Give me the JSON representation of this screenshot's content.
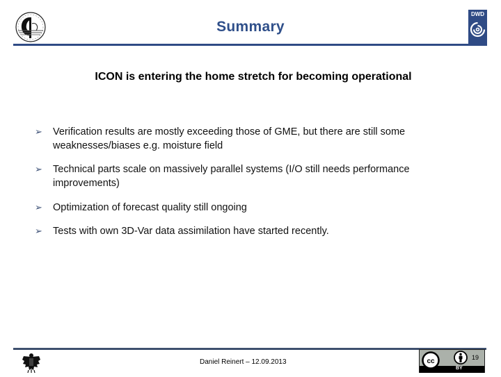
{
  "header": {
    "title": "Summary",
    "left_logo": "institute-emblem-icon",
    "right_logo": {
      "text": "DWD",
      "icon": "dwd-swirl-icon"
    }
  },
  "subtitle": "ICON is entering the home stretch for becoming operational",
  "bullets": [
    {
      "marker": "➢",
      "text": "Verification results are mostly exceeding those of GME, but there are still some weaknesses/biases e.g. moisture field"
    },
    {
      "marker": "➢",
      "text": "Technical parts scale on massively parallel systems (I/O still needs performance improvements)"
    },
    {
      "marker": "➢",
      "text": "Optimization of forecast quality still ongoing"
    },
    {
      "marker": "➢",
      "text": "Tests with own 3D-Var data assimilation have started recently."
    }
  ],
  "footer": {
    "author_date": "Daniel Reinert – 12.09.2013",
    "left_logo": "federal-eagle-icon",
    "license": {
      "cc": "cc",
      "by": "BY"
    },
    "page_number": "19"
  },
  "colors": {
    "title": "#2F4F8A",
    "rule": "#2F4B85",
    "footer_rule": "#3E506E",
    "cc_badge": "#ABB1AA"
  }
}
